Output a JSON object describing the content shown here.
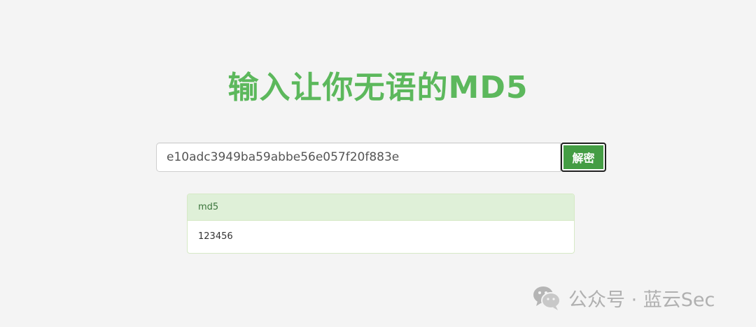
{
  "page": {
    "title": "输入让你无语的MD5"
  },
  "search": {
    "value": "e10adc3949ba59abbe56e057f20f883e",
    "button_label": "解密"
  },
  "result": {
    "heading": "md5",
    "value": "123456"
  },
  "watermark": {
    "text": "公众号 · 蓝云Sec",
    "icon": "wechat-icon"
  },
  "colors": {
    "title": "#5cb85c",
    "button": "#449d44",
    "panel_heading_bg": "#dff0d8",
    "panel_heading_text": "#3c763d",
    "background": "#f4f4f4"
  }
}
